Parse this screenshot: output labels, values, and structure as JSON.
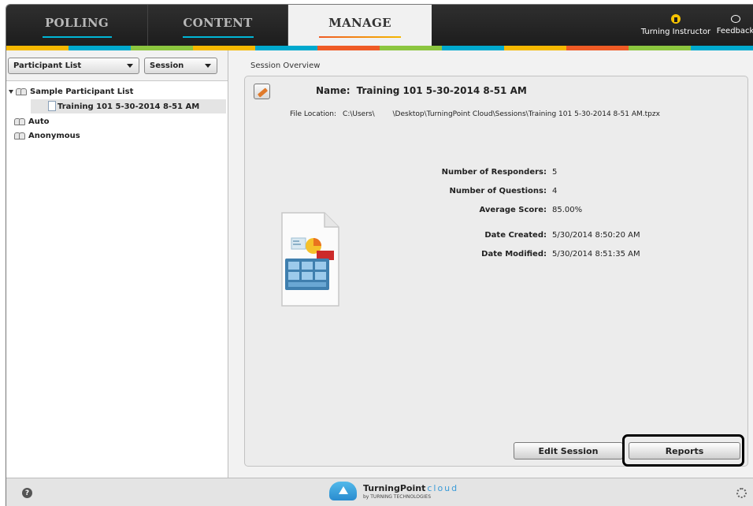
{
  "tabs": [
    {
      "label": "POLLING",
      "underline": "#00b6d6"
    },
    {
      "label": "CONTENT",
      "underline": "#00b6d6"
    },
    {
      "label": "MANAGE",
      "underline": "#ef5b25"
    }
  ],
  "top_right": {
    "instructor_label": "Turning Instructor",
    "feedback_label": "Feedback"
  },
  "stripe_colors": [
    "#f5b800",
    "#00a9ce",
    "#8cc63f",
    "#f5b800",
    "#00a9ce",
    "#ef5b25",
    "#8cc63f",
    "#00a9ce",
    "#f5b800",
    "#ef5b25",
    "#8cc63f",
    "#00a9ce"
  ],
  "left_panel": {
    "participant_dropdown": "Participant List",
    "session_dropdown": "Session",
    "tree": {
      "list_name": "Sample Participant List",
      "session_name": "Training 101 5-30-2014 8-51 AM",
      "auto_label": "Auto",
      "anonymous_label": "Anonymous"
    }
  },
  "session": {
    "section_label": "Session Overview",
    "name_label": "Name:",
    "name_value": "Training 101 5-30-2014 8-51 AM",
    "location_label": "File Location:",
    "location_value": "C:\\Users\\        \\Desktop\\TurningPoint Cloud\\Sessions\\Training 101 5-30-2014 8-51 AM.tpzx",
    "stats": [
      {
        "label": "Number of Responders:",
        "value": "5"
      },
      {
        "label": "Number of Questions:",
        "value": "4"
      },
      {
        "label": "Average Score:",
        "value": "85.00%"
      },
      {
        "label": "Date Created:",
        "value": "5/30/2014 8:50:20 AM"
      },
      {
        "label": "Date Modified:",
        "value": "5/30/2014 8:51:35 AM"
      }
    ],
    "edit_button": "Edit Session",
    "reports_button": "Reports"
  },
  "footer": {
    "logo_turning": "TurningPoint",
    "logo_cloud": "cloud",
    "logo_by": "by TURNING TECHNOLOGIES"
  }
}
